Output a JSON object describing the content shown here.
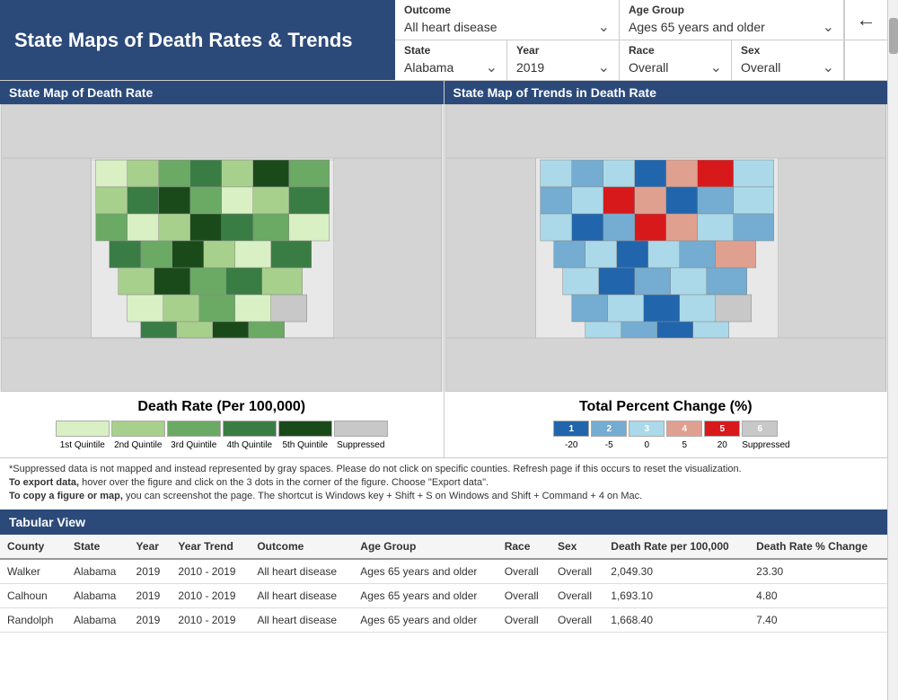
{
  "header": {
    "title": "State Maps of Death Rates & Trends",
    "back_label": "←",
    "outcome": {
      "label": "Outcome",
      "value": "All heart disease"
    },
    "age_group": {
      "label": "Age Group",
      "value": "Ages 65 years and older"
    }
  },
  "filters": {
    "state": {
      "label": "State",
      "value": "Alabama"
    },
    "year": {
      "label": "Year",
      "value": "2019"
    },
    "race": {
      "label": "Race",
      "value": "Overall"
    },
    "sex": {
      "label": "Sex",
      "value": "Overall"
    }
  },
  "map_left": {
    "header": "State Map of Death Rate",
    "legend_title": "Death Rate (Per 100,000)",
    "legend_items": [
      {
        "label": "1st Quintile",
        "color": "#d9f0c4"
      },
      {
        "label": "2nd Quintile",
        "color": "#a8d08d"
      },
      {
        "label": "3rd Quintile",
        "color": "#6aaa64"
      },
      {
        "label": "4th Quintile",
        "color": "#3a7d44"
      },
      {
        "label": "5th Quintile",
        "color": "#1a4a1a"
      },
      {
        "label": "Suppressed",
        "color": "#c8c8c8"
      }
    ]
  },
  "map_right": {
    "header": "State Map of Trends in Death Rate",
    "legend_title": "Total Percent Change (%)",
    "legend_items": [
      {
        "label": "1",
        "color": "#2166ac"
      },
      {
        "label": "2",
        "color": "#74add1"
      },
      {
        "label": "3",
        "color": "#abd9e9"
      },
      {
        "label": "4",
        "color": "#e0a090"
      },
      {
        "label": "5",
        "color": "#d7191c"
      },
      {
        "label": "6",
        "color": "#c8c8c8"
      }
    ],
    "trend_labels": [
      "-20",
      "-5",
      "0",
      "5",
      "20",
      "Suppressed"
    ]
  },
  "notes": {
    "note1": "*Suppressed data is not mapped and instead represented by gray spaces. Please do not click on specific counties. Refresh page if this occurs to reset the visualization.",
    "note2": "To export data, hover over the figure and click on the 3 dots in the corner of the figure. Choose \"Export data\".",
    "note3": "To copy a figure or map, you can screenshot the page. The shortcut is Windows key + Shift + S on Windows and Shift + Command + 4 on Mac."
  },
  "table": {
    "header": "Tabular View",
    "columns": [
      "County",
      "State",
      "Year",
      "Year Trend",
      "Outcome",
      "Age Group",
      "Race",
      "Sex",
      "Death Rate per 100,000",
      "Death Rate % Change"
    ],
    "rows": [
      {
        "county": "Walker",
        "state": "Alabama",
        "year": "2019",
        "year_trend": "2010 - 2019",
        "outcome": "All heart disease",
        "age_group": "Ages 65 years and older",
        "race": "Overall",
        "sex": "Overall",
        "death_rate": "2,049.30",
        "death_rate_change": "23.30"
      },
      {
        "county": "Calhoun",
        "state": "Alabama",
        "year": "2019",
        "year_trend": "2010 - 2019",
        "outcome": "All heart disease",
        "age_group": "Ages 65 years and older",
        "race": "Overall",
        "sex": "Overall",
        "death_rate": "1,693.10",
        "death_rate_change": "4.80"
      },
      {
        "county": "Randolph",
        "state": "Alabama",
        "year": "2019",
        "year_trend": "2010 - 2019",
        "outcome": "All heart disease",
        "age_group": "Ages 65 years and older",
        "race": "Overall",
        "sex": "Overall",
        "death_rate": "1,668.40",
        "death_rate_change": "7.40"
      }
    ]
  }
}
